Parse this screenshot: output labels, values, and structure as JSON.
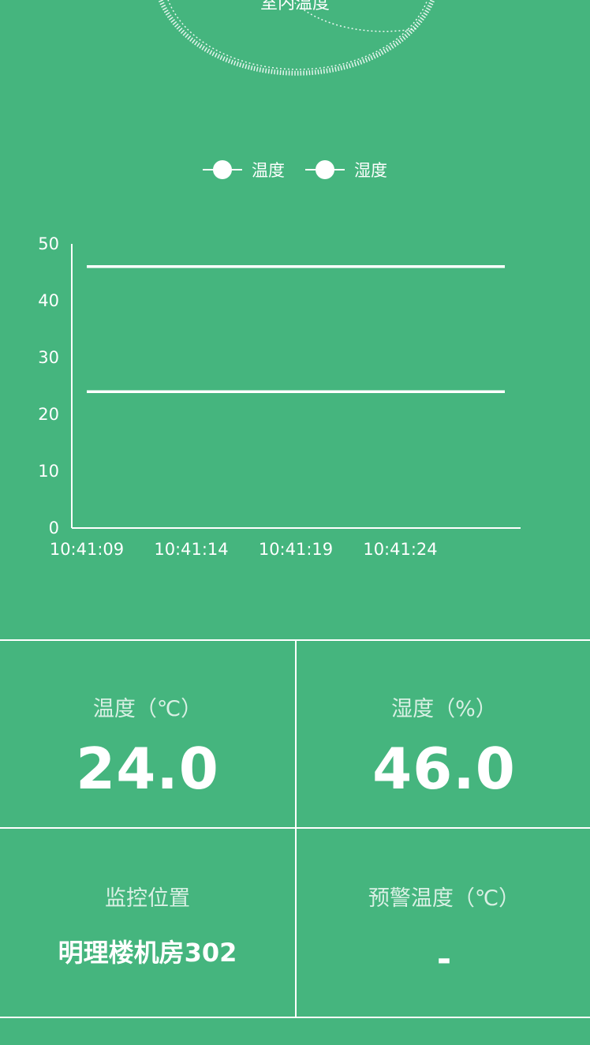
{
  "gauge": {
    "label": "室内温度"
  },
  "legend": {
    "items": [
      {
        "label": "温度"
      },
      {
        "label": "湿度"
      }
    ]
  },
  "chart_data": {
    "type": "line",
    "x": [
      "10:41:09",
      "10:41:14",
      "10:41:19",
      "10:41:24"
    ],
    "x_start": "10:41:09",
    "x_end": "10:41:29",
    "series": [
      {
        "name": "温度",
        "values": [
          24,
          24,
          24,
          24
        ]
      },
      {
        "name": "湿度",
        "values": [
          46,
          46,
          46,
          46
        ]
      }
    ],
    "yticks": [
      0,
      10,
      20,
      30,
      40,
      50
    ],
    "ylim": [
      0,
      50
    ],
    "grid": false,
    "legend_placement": "top-center",
    "color": "#ffffff"
  },
  "panels": {
    "temperature": {
      "label": "温度（℃）",
      "value": "24.0"
    },
    "humidity": {
      "label": "湿度（%）",
      "value": "46.0"
    },
    "location": {
      "label": "监控位置",
      "value": "明理楼机房302"
    },
    "warning": {
      "label": "预警温度（℃）",
      "value": "-"
    }
  },
  "colors": {
    "background": "#45b57e",
    "foreground": "#ffffff"
  }
}
